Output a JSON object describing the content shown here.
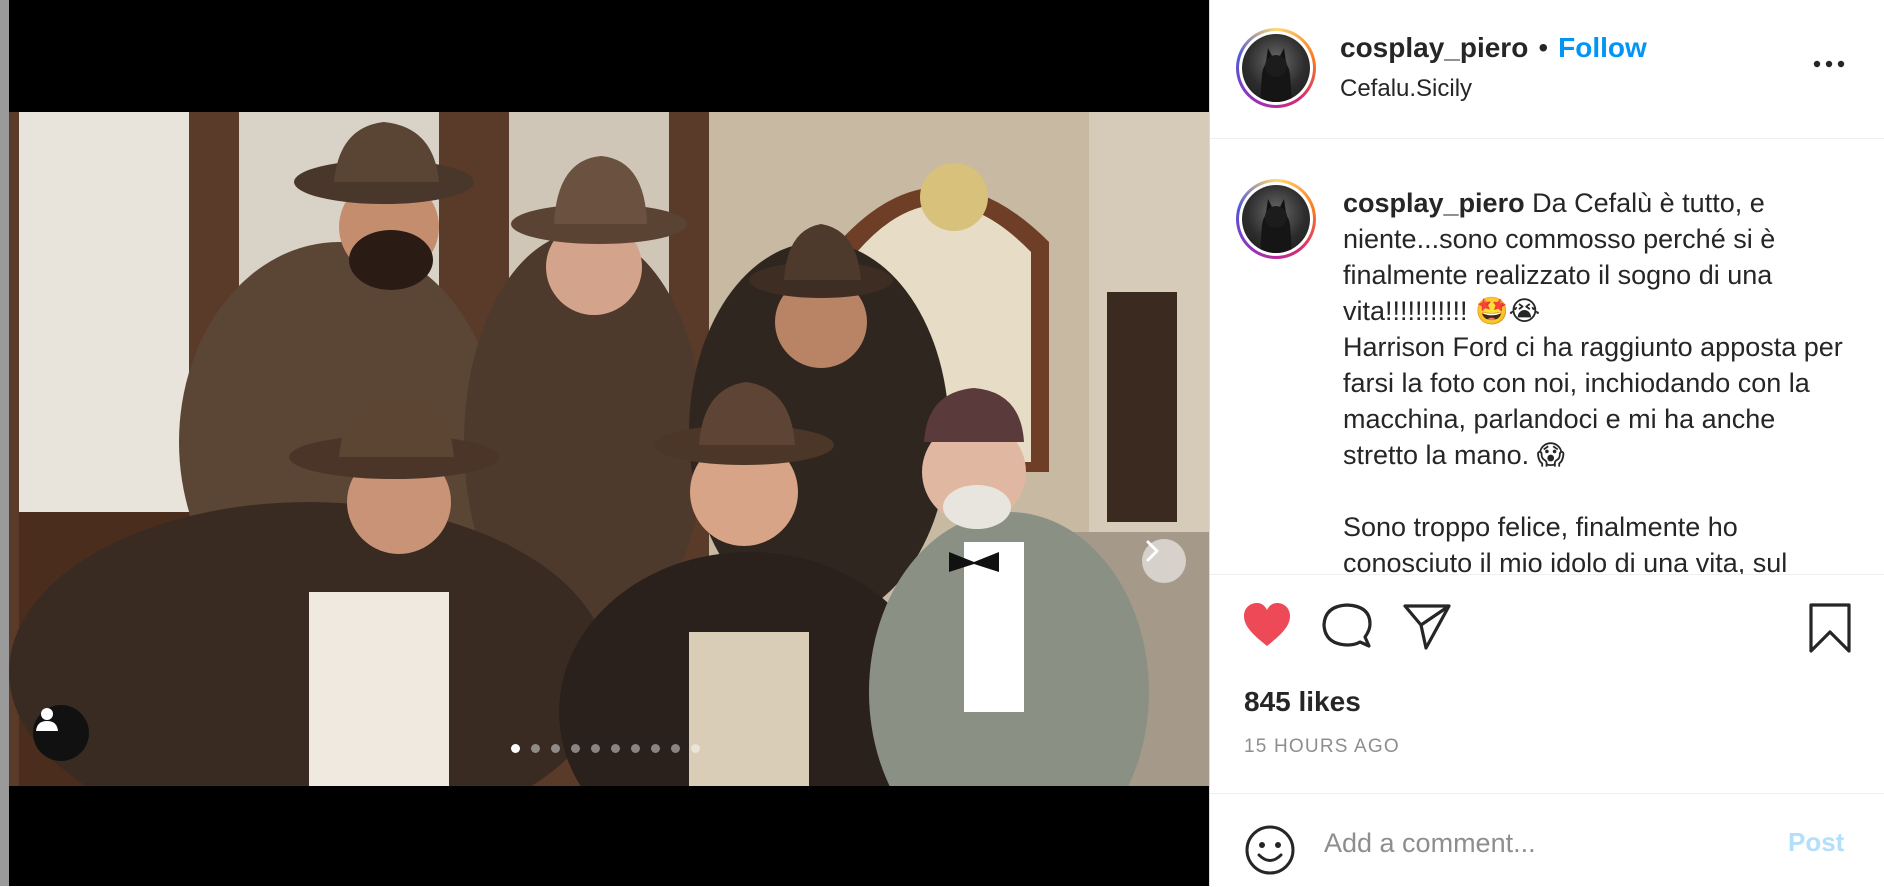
{
  "post": {
    "username": "cosplay_piero",
    "follow_label": "Follow",
    "separator": "•",
    "location": "Cefalu.Sicily",
    "caption_body": "Da Cefalù è tutto, e niente...sono commosso perché si è finalmente realizzato il sogno di una vita!!!!!!!!!!! 🤩😭\nHarrison Ford ci ha raggiunto apposta per farsi la foto con noi, inchiodando con la macchina, parlandoci e mi ha anche stretto la mano. 😱\n\nSono troppo felice, finalmente ho conosciuto il mio idolo di una vita, sul",
    "likes": "845 likes",
    "timestamp": "15 HOURS AGO"
  },
  "carousel": {
    "total": 10,
    "active_index": 1
  },
  "comment": {
    "placeholder": "Add a comment...",
    "post_label": "Post"
  },
  "icons": {
    "like": "heart-icon",
    "comment": "comment-icon",
    "share": "send-icon",
    "save": "bookmark-icon",
    "more": "more-options-icon",
    "emoji": "emoji-icon",
    "next": "chevron-right-icon",
    "tag": "user-tag-icon"
  },
  "colors": {
    "like": "#ed4956",
    "link": "#0095f6",
    "post_disabled": "#b2dffc"
  }
}
